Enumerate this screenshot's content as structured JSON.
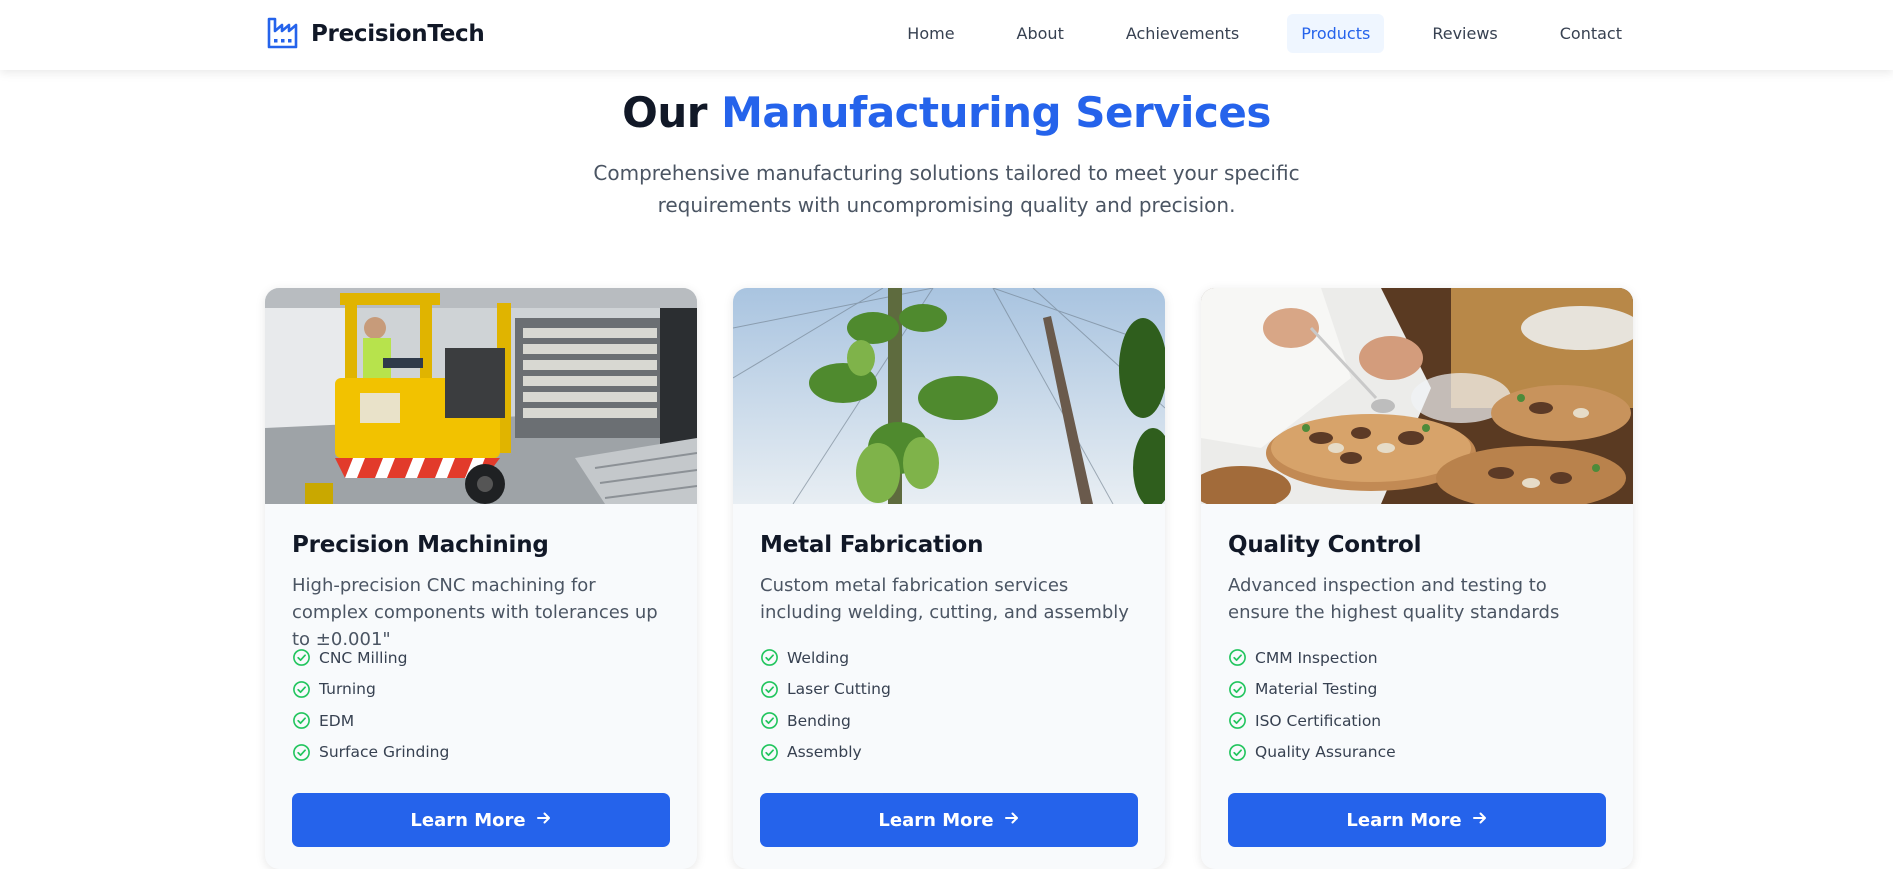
{
  "brand": {
    "name": "PrecisionTech",
    "icon": "factory-icon",
    "color": "#2563eb"
  },
  "nav": {
    "items": [
      {
        "label": "Home"
      },
      {
        "label": "About"
      },
      {
        "label": "Achievements"
      },
      {
        "label": "Products",
        "active": true
      },
      {
        "label": "Reviews"
      },
      {
        "label": "Contact"
      }
    ]
  },
  "hero": {
    "title_prefix": "Our",
    "title_accent": "Manufacturing Services",
    "subtitle": "Comprehensive manufacturing solutions tailored to meet your specific requirements with uncompromising quality and precision."
  },
  "services": [
    {
      "image": "forklift-warehouse-photo",
      "title": "Precision Machining",
      "description": "High-precision CNC machining for complex components with tolerances up to ±0.001\"",
      "features": [
        "CNC Milling",
        "Turning",
        "EDM",
        "Surface Grinding"
      ],
      "button": "Learn More"
    },
    {
      "image": "hop-plant-sky-photo",
      "title": "Metal Fabrication",
      "description": "Custom metal fabrication services including welding, cutting, and assembly",
      "features": [
        "Welding",
        "Laser Cutting",
        "Bending",
        "Assembly"
      ],
      "button": "Learn More"
    },
    {
      "image": "chef-plating-food-photo",
      "title": "Quality Control",
      "description": "Advanced inspection and testing to ensure the highest quality standards",
      "features": [
        "CMM Inspection",
        "Material Testing",
        "ISO Certification",
        "Quality Assurance"
      ],
      "button": "Learn More"
    }
  ],
  "colors": {
    "accent": "#2563eb",
    "check": "#22c55e",
    "card_bg": "#f8fafc",
    "text_muted": "#4b5563"
  }
}
